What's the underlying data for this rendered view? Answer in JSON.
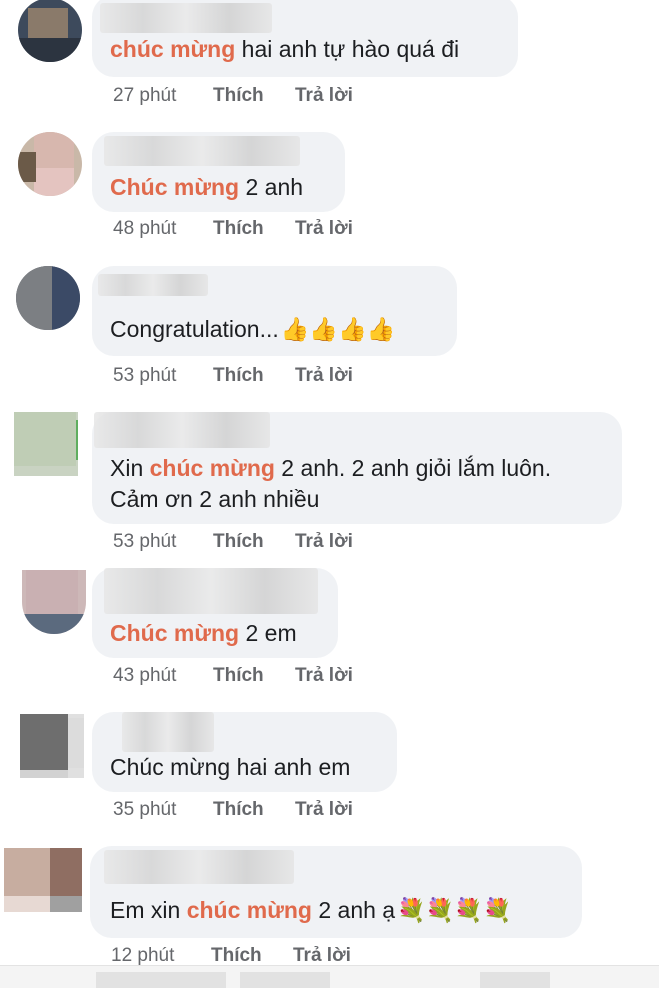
{
  "comments": [
    {
      "time": "27 phút",
      "like": "Thích",
      "reply": "Trả lời",
      "hl": "chúc mừng",
      "after": " hai anh tự hào quá đi"
    },
    {
      "time": "48 phút",
      "like": "Thích",
      "reply": "Trả lời",
      "hl": "Chúc mừng",
      "after": " 2 anh"
    },
    {
      "time": "53 phút",
      "like": "Thích",
      "reply": "Trả lời",
      "name_partial": "Hùng vo",
      "text": "Congratulation...",
      "emoji": "👍👍👍👍"
    },
    {
      "time": "53 phút",
      "like": "Thích",
      "reply": "Trả lời",
      "before": "Xin ",
      "hl": "chúc mừng",
      "after": " 2 anh. 2 anh giỏi lắm luôn.",
      "line2": "Cảm ơn 2 anh nhiều"
    },
    {
      "time": "43 phút",
      "like": "Thích",
      "reply": "Trả lời",
      "hl": "Chúc mừng",
      "after": " 2 em"
    },
    {
      "time": "35 phút",
      "like": "Thích",
      "reply": "Trả lời",
      "name_partial": "M",
      "text": "Chúc mừng hai anh em"
    },
    {
      "time": "12 phút",
      "like": "Thích",
      "reply": "Trả lời",
      "before": "Em xin ",
      "hl": "chúc mừng",
      "after": " 2 anh ạ",
      "emoji": "💐💐💐💐"
    }
  ],
  "colors": {
    "highlight": "#e06a4c",
    "bubble": "#f0f2f5",
    "meta": "#65676b"
  }
}
